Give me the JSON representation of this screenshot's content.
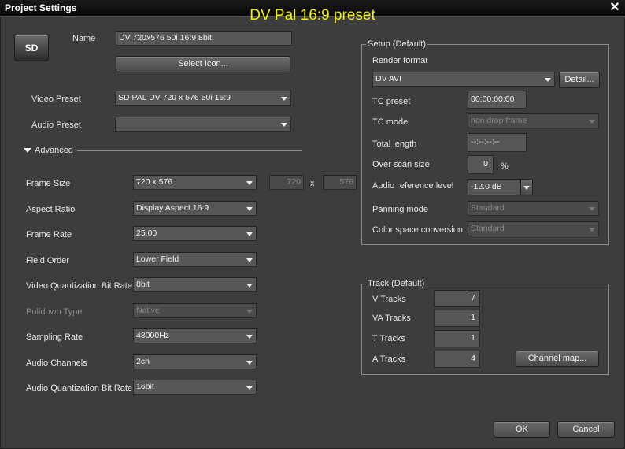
{
  "window": {
    "title": "Project Settings",
    "overlay_title": "DV Pal 16:9 preset",
    "close_glyph": "✕"
  },
  "badge": {
    "label": "SD"
  },
  "name": {
    "label": "Name",
    "value": "DV 720x576 50i 16:9 8bit"
  },
  "select_icon_button": "Select Icon...",
  "video_preset": {
    "label": "Video Preset",
    "value": "SD PAL DV 720 x 576 50i 16:9"
  },
  "audio_preset": {
    "label": "Audio Preset",
    "value": ""
  },
  "advanced": {
    "label": "Advanced",
    "frame_size": {
      "label": "Frame Size",
      "value": "720 x 576",
      "width": "720",
      "height": "576",
      "times": "x"
    },
    "aspect_ratio": {
      "label": "Aspect Ratio",
      "value": "Display Aspect 16:9"
    },
    "frame_rate": {
      "label": "Frame Rate",
      "value": "25.00"
    },
    "field_order": {
      "label": "Field Order",
      "value": "Lower Field"
    },
    "video_quant": {
      "label": "Video Quantization Bit Rate",
      "value": "8bit"
    },
    "pulldown": {
      "label": "Pulldown Type",
      "value": "Native"
    },
    "sampling_rate": {
      "label": "Sampling Rate",
      "value": "48000Hz"
    },
    "audio_channels": {
      "label": "Audio Channels",
      "value": "2ch"
    },
    "audio_quant": {
      "label": "Audio Quantization Bit Rate",
      "value": "16bit"
    }
  },
  "setup": {
    "title": "Setup (Default)",
    "render_format": {
      "label": "Render format",
      "value": "DV AVI",
      "detail_button": "Detail..."
    },
    "tc_preset": {
      "label": "TC preset",
      "value": "00:00:00:00"
    },
    "tc_mode": {
      "label": "TC mode",
      "value": "non drop frame"
    },
    "total_length": {
      "label": "Total length",
      "value": "--:--:--:--"
    },
    "over_scan": {
      "label": "Over scan size",
      "value": "0",
      "unit": "%"
    },
    "audio_ref": {
      "label": "Audio reference level",
      "value": "-12.0 dB"
    },
    "panning_mode": {
      "label": "Panning mode",
      "value": "Standard"
    },
    "color_space": {
      "label": "Color space conversion",
      "value": "Standard"
    }
  },
  "track": {
    "title": "Track (Default)",
    "v_tracks": {
      "label": "V Tracks",
      "value": "7"
    },
    "va_tracks": {
      "label": "VA Tracks",
      "value": "1"
    },
    "t_tracks": {
      "label": "T Tracks",
      "value": "1"
    },
    "a_tracks": {
      "label": "A Tracks",
      "value": "4"
    },
    "channel_map_button": "Channel map..."
  },
  "footer": {
    "ok": "OK",
    "cancel": "Cancel"
  }
}
